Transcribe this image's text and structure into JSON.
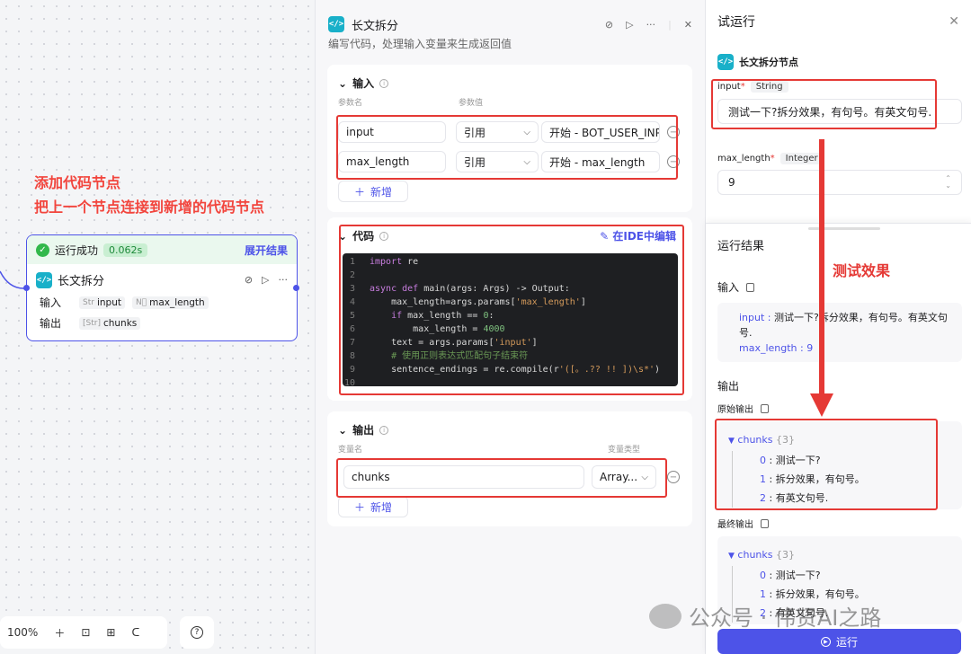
{
  "canvas": {
    "annotation_line1": "添加代码节点",
    "annotation_line2": "把上一个节点连接到新增的代码节点",
    "node": {
      "status_label": "运行成功",
      "time": "0.062s",
      "expand_label": "展开结果",
      "title": "长文拆分",
      "input_label": "输入",
      "output_label": "输出",
      "inputs": [
        {
          "type": "Str",
          "name": "input"
        },
        {
          "type": "N⃞",
          "name": "max_length"
        }
      ],
      "outputs": [
        {
          "type": "[Str]",
          "name": "chunks"
        }
      ]
    },
    "zoom": "100%"
  },
  "editor": {
    "title": "长文拆分",
    "description": "编写代码，处理输入变量来生成返回值",
    "input_section": "输入",
    "col_param_name": "参数名",
    "col_param_value": "参数值",
    "inputs": [
      {
        "name": "input",
        "mode": "引用",
        "ref": "开始 - BOT_USER_INPUT"
      },
      {
        "name": "max_length",
        "mode": "引用",
        "ref": "开始 - max_length"
      }
    ],
    "add_label": "新增",
    "code_section": "代码",
    "ide_label": "在IDE中编辑",
    "code_lines": [
      "1",
      "2",
      "3",
      "4",
      "5",
      "6",
      "7",
      "8",
      "9",
      "10"
    ],
    "output_section": "输出",
    "col_var_name": "变量名",
    "col_var_type": "变量类型",
    "outputs": [
      {
        "name": "chunks",
        "type": "Array..."
      }
    ]
  },
  "run": {
    "title": "试运行",
    "node_title": "长文拆分节点",
    "params": [
      {
        "name": "input",
        "type": "String",
        "value": "测试一下?拆分效果，有句号。有英文句号."
      },
      {
        "name": "max_length",
        "type": "Integer",
        "value": "9"
      }
    ],
    "result_title": "运行结果",
    "input_heading": "输入",
    "input_text_key": "input",
    "input_text_value": "测试一下?拆分效果，有句号。有英文句号.",
    "input_len_key": "max_length",
    "input_len_value": "9",
    "output_heading": "输出",
    "raw_output_label": "原始输出",
    "final_output_label": "最终输出",
    "chunks_key": "chunks",
    "chunks_count": "{3}",
    "chunks": [
      {
        "index": "0",
        "value": "测试一下?"
      },
      {
        "index": "1",
        "value": "拆分效果，有句号。"
      },
      {
        "index": "2",
        "value": "有英文句号."
      }
    ],
    "run_button": "运行",
    "test_annotation": "测试效果"
  },
  "watermark": "公众号 · 伟贤AI之路",
  "colors": {
    "accent": "#4d53e8",
    "annotation": "#e53935",
    "success": "#32b84b"
  }
}
